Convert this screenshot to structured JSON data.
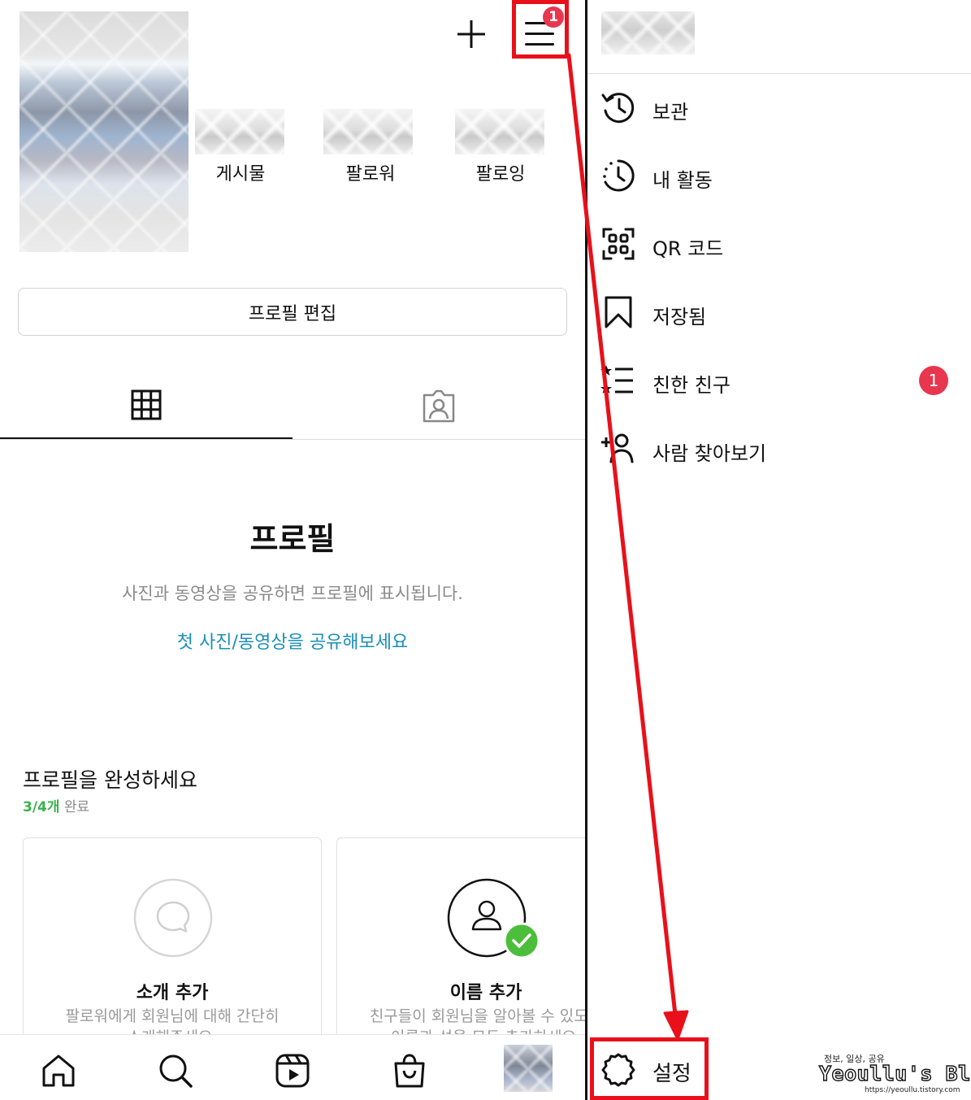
{
  "profile": {
    "stats": [
      {
        "label": "게시물"
      },
      {
        "label": "팔로워"
      },
      {
        "label": "팔로잉"
      }
    ],
    "edit_button": "프로필 편집",
    "menu_badge": "1"
  },
  "empty_state": {
    "title": "프로필",
    "subtitle": "사진과 동영상을 공유하면 프로필에 표시됩니다.",
    "link": "첫 사진/동영상을 공유해보세요"
  },
  "complete_profile": {
    "title": "프로필을 완성하세요",
    "progress_count": "3/4개",
    "progress_suffix": "완료",
    "cards": [
      {
        "title": "소개 추가",
        "desc_line1": "팔로워에게 회원님에 대해 간단히",
        "desc_line2": "소개해주세요."
      },
      {
        "title": "이름 추가",
        "desc_line1": "친구들이 회원님을 알아볼 수 있도록",
        "desc_line2": "이름과 성을 모두 추가하세요."
      }
    ]
  },
  "bottom_nav": [
    "home-icon",
    "search-icon",
    "reels-icon",
    "shop-icon",
    "profile-avatar"
  ],
  "menu": {
    "items": [
      {
        "label": "보관",
        "icon": "archive-icon"
      },
      {
        "label": "내 활동",
        "icon": "activity-icon"
      },
      {
        "label": "QR 코드",
        "icon": "qr-code-icon"
      },
      {
        "label": "저장됨",
        "icon": "bookmark-icon"
      },
      {
        "label": "친한 친구",
        "icon": "close-friends-icon",
        "badge": "1"
      },
      {
        "label": "사람 찾아보기",
        "icon": "discover-people-icon"
      }
    ],
    "settings_label": "설정"
  },
  "watermark": {
    "tagline": "정보, 일상, 공유",
    "title": "Yeoullu's Blog",
    "url": "https://yeoullu.tistory.com"
  },
  "colors": {
    "annotation_red": "#e8101a",
    "badge_red": "#e8364f",
    "link_blue": "#1a8fb8",
    "progress_green": "#3db24b",
    "check_green": "#4cbe3c"
  }
}
